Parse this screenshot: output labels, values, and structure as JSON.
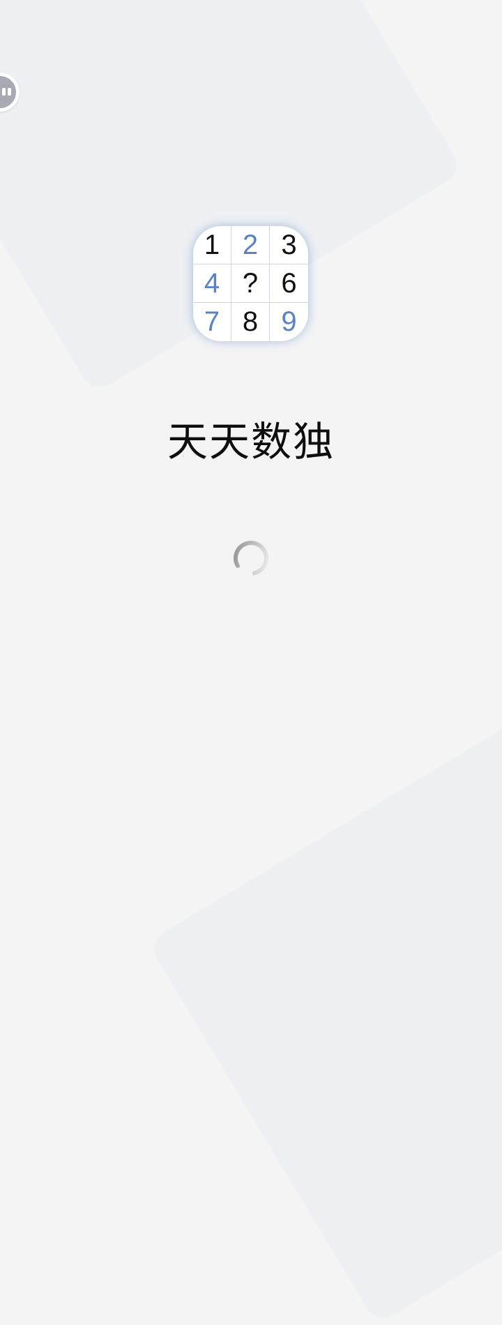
{
  "app": {
    "title": "天天数独"
  },
  "icon": {
    "grid": [
      "1",
      "2",
      "3",
      "4",
      "?",
      "6",
      "7",
      "8",
      "9"
    ]
  },
  "colors": {
    "background": "#f4f4f5",
    "accent_blue": "#5a82c5",
    "digit_dark": "#111111"
  },
  "floating_button": {
    "icon": "pause-icon"
  },
  "loading": {
    "icon": "loading-spinner-icon"
  }
}
